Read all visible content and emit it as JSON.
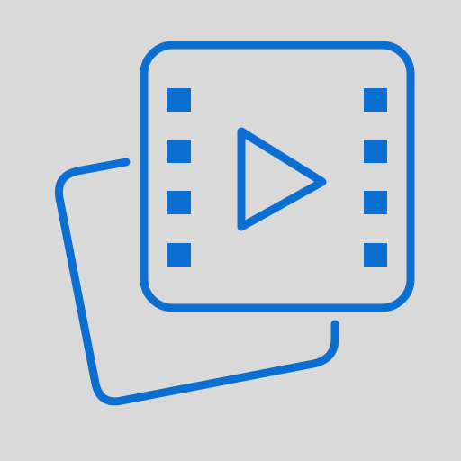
{
  "icon": {
    "name": "video-library-icon",
    "background_color": "#d9d9d9",
    "stroke_color": "#0a6fd1",
    "parts": {
      "back_card": "back-card-icon",
      "film_frame": "film-frame-icon",
      "play": "play-triangle-icon",
      "perforations": "film-perforation-icon"
    }
  }
}
